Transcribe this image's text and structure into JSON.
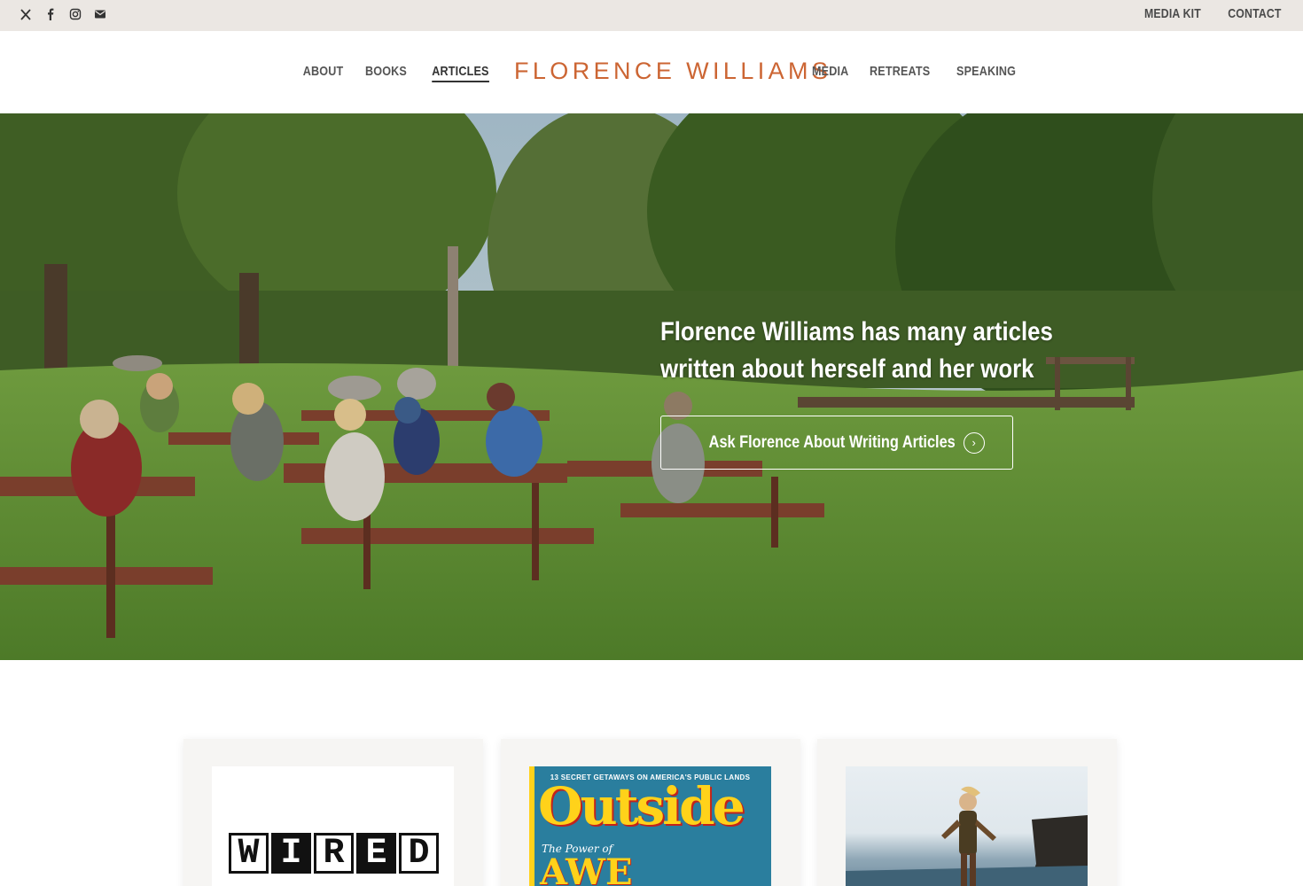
{
  "topbar": {
    "social_icons": [
      "x-icon",
      "facebook-icon",
      "instagram-icon",
      "envelope-icon"
    ],
    "links": [
      "MEDIA KIT",
      "CONTACT"
    ]
  },
  "nav": {
    "brand": "FLORENCE WILLIAMS",
    "left": [
      "ABOUT",
      "BOOKS",
      "ARTICLES"
    ],
    "right": [
      "MEDIA",
      "RETREATS",
      "SPEAKING"
    ],
    "active": "ARTICLES",
    "brand_color": "#cc6533"
  },
  "hero": {
    "heading_line1": "Florence Williams has many articles",
    "heading_line2": "written about herself and her work",
    "button_label": "Ask Florence About Writing Articles",
    "button_icon": "chevron-right-circle-icon"
  },
  "cards": [
    {
      "logo_letters": [
        "W",
        "I",
        "R",
        "E",
        "D"
      ]
    },
    {
      "tagline": "13 SECRET GETAWAYS ON AMERICA'S PUBLIC LANDS",
      "masthead": "Outside",
      "subtitle": "The Power of",
      "headline": "AWE"
    },
    {
      "image": "woman-on-coast-photo"
    }
  ]
}
